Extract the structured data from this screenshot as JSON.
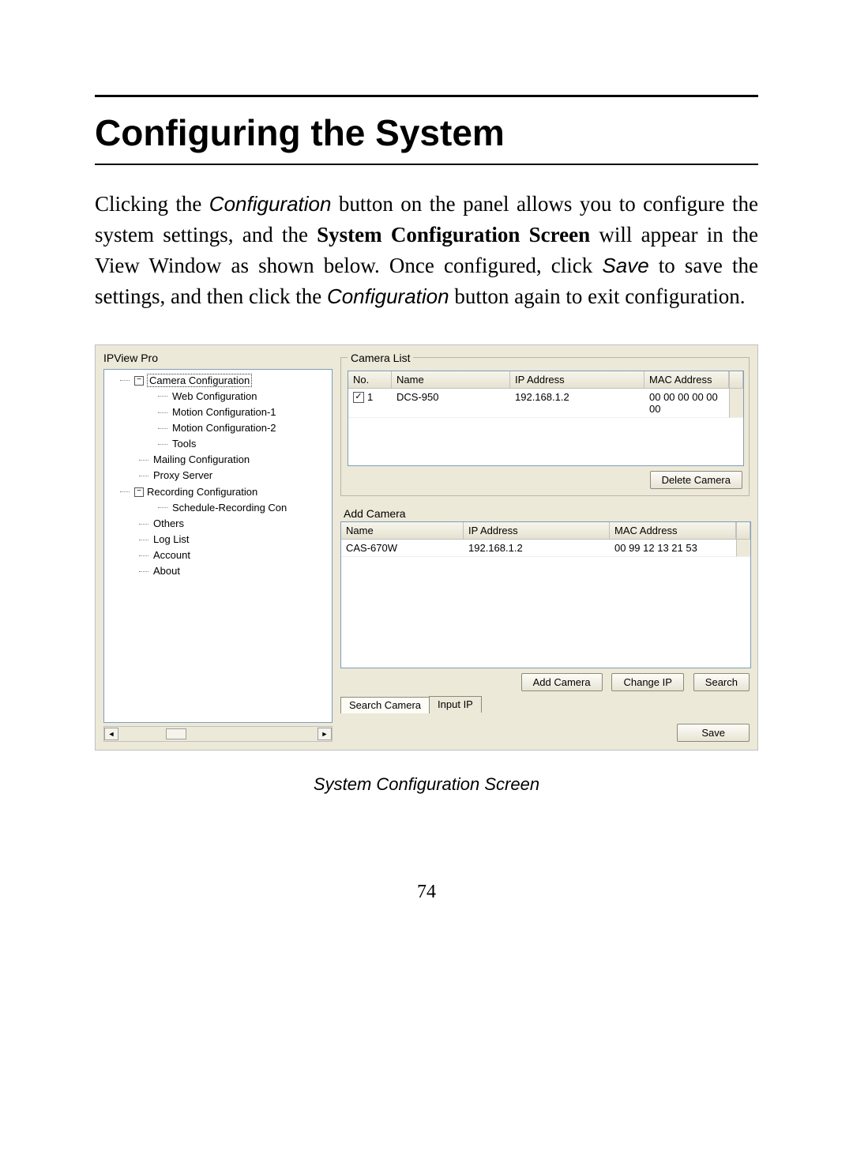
{
  "heading": "Configuring the System",
  "para": {
    "seg1": "Clicking the ",
    "seg2_i": "Configuration",
    "seg3": " button on the panel allows you to configure the system settings, and the ",
    "seg4_b": "System Configuration Screen",
    "seg5": " will appear in the View Window as shown below.  Once configured, click ",
    "seg6_i": "Save",
    "seg7": " to save the settings, and then click the ",
    "seg8_i": "Configuration",
    "seg9": " button again to exit configuration."
  },
  "app_title": "IPView Pro",
  "tree": {
    "camera_configuration": "Camera Configuration",
    "web_configuration": "Web Configuration",
    "motion1": "Motion Configuration-1",
    "motion2": "Motion Configuration-2",
    "tools": "Tools",
    "mailing": "Mailing Configuration",
    "proxy": "Proxy Server",
    "recording": "Recording Configuration",
    "schedule": "Schedule-Recording Con",
    "others": "Others",
    "loglist": "Log List",
    "account": "Account",
    "about": "About"
  },
  "camera_list": {
    "legend": "Camera List",
    "headers": {
      "no": "No.",
      "name": "Name",
      "ip": "IP Address",
      "mac": "MAC Address"
    },
    "rows": [
      {
        "no": "1",
        "name": "DCS-950",
        "ip": "192.168.1.2",
        "mac": "00 00 00 00 00 00",
        "checked": true
      }
    ],
    "delete_btn": "Delete Camera"
  },
  "add_camera": {
    "legend": "Add Camera",
    "headers": {
      "name": "Name",
      "ip": "IP Address",
      "mac": "MAC Address"
    },
    "rows": [
      {
        "name": "CAS-670W",
        "ip": "192.168.1.2",
        "mac": "00 99 12 13 21 53"
      }
    ],
    "buttons": {
      "add": "Add Camera",
      "change_ip": "Change IP",
      "search": "Search"
    },
    "tabs": {
      "search": "Search Camera",
      "input": "Input IP"
    }
  },
  "save_btn": "Save",
  "caption": "System Configuration Screen",
  "page_number": "74",
  "minus": "−"
}
